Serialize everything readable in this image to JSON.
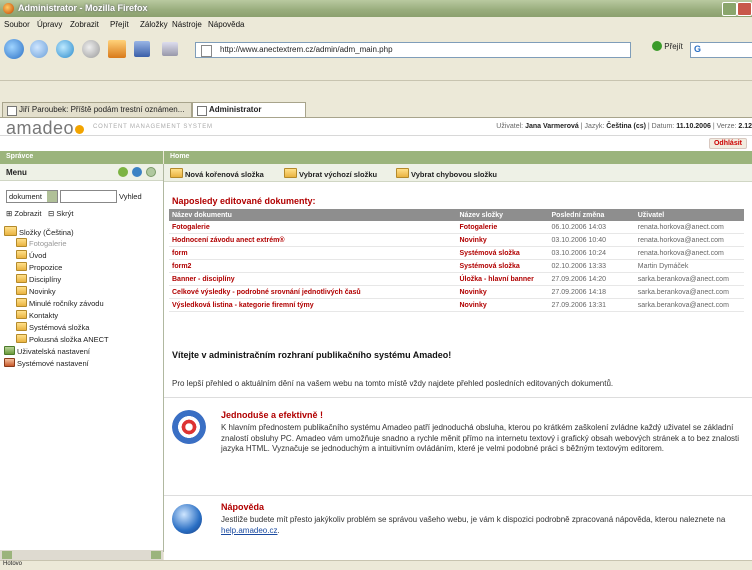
{
  "window": {
    "title": "Administrator - Mozilla Firefox"
  },
  "menu": [
    "Soubor",
    "Úpravy",
    "Zobrazit",
    "Přejít",
    "Záložky",
    "Nástroje",
    "Nápověda"
  ],
  "address": {
    "url": "http://www.anectextrem.cz/admin/adm_main.php",
    "go_label": "Přejít",
    "search_engine": "G"
  },
  "tabs": [
    {
      "label": "Jiří Paroubek: Příště podám trestní oznámen..."
    },
    {
      "label": "Administrator"
    }
  ],
  "header": {
    "logo": "amadeo",
    "tagline": "CONTENT MANAGEMENT SYSTEM",
    "user_label": "Uživatel:",
    "user_name": "Jana Varmerová",
    "lang_label": "| Jazyk:",
    "lang_value": "Čeština (cs)",
    "date_label": "| Datum:",
    "date_value": "11.10.2006",
    "version_label": "| Verze:",
    "version_value": "2.12",
    "logout": "Odhlásit"
  },
  "left": {
    "section_title": "Správce",
    "menu_title": "Menu",
    "select_value": "dokument",
    "search_label": "Vyhled",
    "expand_all": "Zobrazit",
    "collapse_all": "Skrýt",
    "tree": [
      {
        "label": "Složky (Čeština)",
        "level": 0
      },
      {
        "label": "Fotogalerie",
        "level": 1,
        "muted": true
      },
      {
        "label": "Úvod",
        "level": 1
      },
      {
        "label": "Propozice",
        "level": 1
      },
      {
        "label": "Disciplíny",
        "level": 1
      },
      {
        "label": "Novinky",
        "level": 1
      },
      {
        "label": "Minulé ročníky závodu",
        "level": 1
      },
      {
        "label": "Kontakty",
        "level": 1
      },
      {
        "label": "Systémová složka",
        "level": 1
      },
      {
        "label": "Pokusná složka ANECT",
        "level": 1
      },
      {
        "label": "Uživatelská nastavení",
        "level": 0
      },
      {
        "label": "Systémové nastavení",
        "level": 0
      }
    ]
  },
  "right": {
    "section_title": "Home",
    "toolbar": [
      "Nová kořenová složka",
      "Vybrat výchozí složku",
      "Vybrat chybovou složku"
    ],
    "recent_title": "Naposledy editované dokumenty:",
    "table": {
      "headers": [
        "Název dokumentu",
        "Název složky",
        "Poslední změna",
        "Uživatel"
      ],
      "rows": [
        [
          "Fotogalerie",
          "Fotogalerie",
          "06.10.2006 14:03",
          "renata.horkova@anect.com"
        ],
        [
          "Hodnocení závodu anect extrém®",
          "Novinky",
          "03.10.2006 10:40",
          "renata.horkova@anect.com"
        ],
        [
          "form",
          "Systémová složka",
          "03.10.2006 10:24",
          "renata.horkova@anect.com"
        ],
        [
          "form2",
          "Systémová složka",
          "02.10.2006 13:33",
          "Martin Dymáček"
        ],
        [
          "Banner - disciplíny",
          "Úložka - hlavní banner",
          "27.09.2006 14:20",
          "sarka.berankova@anect.com"
        ],
        [
          "Celkové výsledky - podrobné srovnání jednotlivých časů",
          "Novinky",
          "27.09.2006 14:18",
          "sarka.berankova@anect.com"
        ],
        [
          "Výsledková listina - kategorie firemní týmy",
          "Novinky",
          "27.09.2006 13:31",
          "sarka.berankova@anect.com"
        ]
      ]
    },
    "welcome": "Vítejte v administračním rozhraní publikačního systému Amadeo!",
    "intro": "Pro lepší přehled o aktuálním dění na vašem webu na tomto místě vždy najdete přehled posledních editovaných dokumentů.",
    "sec1_title": "Jednoduše a efektivně !",
    "sec1_text": "K hlavním přednostem publikačního systému Amadeo patří jednoduchá obsluha, kterou po krátkém zaškolení zvládne každý uživatel se základní znalostí obsluhy PC. Amadeo vám umožňuje snadno a rychle měnit přímo na internetu textový i grafický obsah webových stránek a to bez znalosti jazyka HTML. Vyznačuje se jednoduchým a intuitivním ovládáním, které je velmi podobné práci s běžným textovým editorem.",
    "sec2_title": "Nápověda",
    "sec2_text": "Jestliže budete mít přesto jakýkoliv problém se správou vašeho webu, je vám k dispozici podrobně zpracovaná nápověda, kterou naleznete na",
    "sec2_link": "help.amadeo.cz",
    "sec2_end": "."
  },
  "status": "Hotovo"
}
